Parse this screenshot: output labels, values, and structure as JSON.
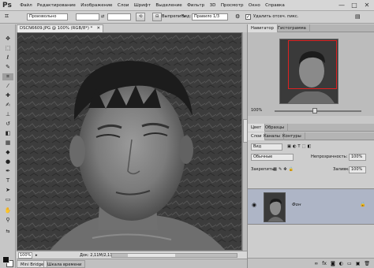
{
  "app": {
    "logo": "Ps"
  },
  "menu": [
    "Файл",
    "Редактирование",
    "Изображение",
    "Слои",
    "Шрифт",
    "Выделение",
    "Фильтр",
    "3D",
    "Просмотр",
    "Окно",
    "Справка"
  ],
  "window_controls": {
    "minimize": "—",
    "maximize": "□",
    "close": "✕"
  },
  "options": {
    "style_value": "Произвольно",
    "width_value": "",
    "height_value": "",
    "clear_label": "Выпрепить",
    "view_label": "Вид:",
    "view_value": "Правило 1/3",
    "delete_label": "Удалить отсеч. пикс."
  },
  "document": {
    "tab_title": "DSCN6609.JPG @ 100% (RGB/8*) *",
    "tab_close": "✕",
    "zoom": "100%",
    "doc_info": "Док: 2,11M/2,11M"
  },
  "bottom_tabs": [
    "Mini Bridge",
    "Шкала времени"
  ],
  "navigator": {
    "tabs": [
      "Навигатор",
      "Гистограмма"
    ],
    "zoom": "100%"
  },
  "color_tabs": [
    "Цвет",
    "Образцы"
  ],
  "layers": {
    "tabs": [
      "Слои",
      "Каналы",
      "Контуры"
    ],
    "filter_value": "Вид",
    "blend_mode": "Обычные",
    "opacity_label": "Непрозрачность:",
    "opacity_value": "100%",
    "lock_label": "Закрепить:",
    "fill_label": "Заливка:",
    "fill_value": "100%",
    "layer_name": "Фон"
  },
  "icons": [
    "crop-icon",
    "gear-icon",
    "eye-icon",
    "lock-icon"
  ]
}
